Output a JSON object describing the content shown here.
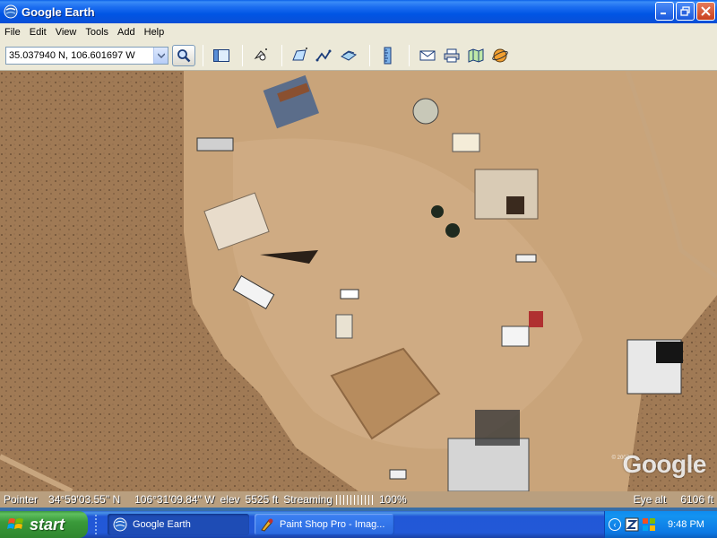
{
  "window": {
    "title": "Google Earth"
  },
  "menu": {
    "items": [
      "File",
      "Edit",
      "View",
      "Tools",
      "Add",
      "Help"
    ]
  },
  "toolbar": {
    "search_value": "35.037940 N, 106.601697 W",
    "icons": [
      "sidebar-toggle-icon",
      "placemark-icon",
      "polygon-icon",
      "path-icon",
      "image-overlay-icon",
      "ruler-icon",
      "email-icon",
      "print-icon",
      "map-icon",
      "sky-icon"
    ]
  },
  "map": {
    "logo": "Google",
    "copyright": "© 2007"
  },
  "status": {
    "pointer_label": "Pointer",
    "lat": "34°59'03.55\" N",
    "lon": "106°31'09.84\" W",
    "elev_label": "elev",
    "elev": "5525 ft",
    "streaming_label": "Streaming",
    "streaming_pct": "100%",
    "eye_label": "Eye alt",
    "eye_alt": "6106 ft"
  },
  "taskbar": {
    "start_label": "start",
    "tasks": [
      {
        "label": "Google Earth",
        "active": true
      },
      {
        "label": "Paint Shop Pro - Imag...",
        "active": false
      }
    ],
    "clock": "9:48 PM"
  },
  "colors": {
    "titlebar": "#0055e5",
    "taskbar": "#2259d7",
    "start": "#3a9a3a",
    "ground": "#b8936a"
  }
}
